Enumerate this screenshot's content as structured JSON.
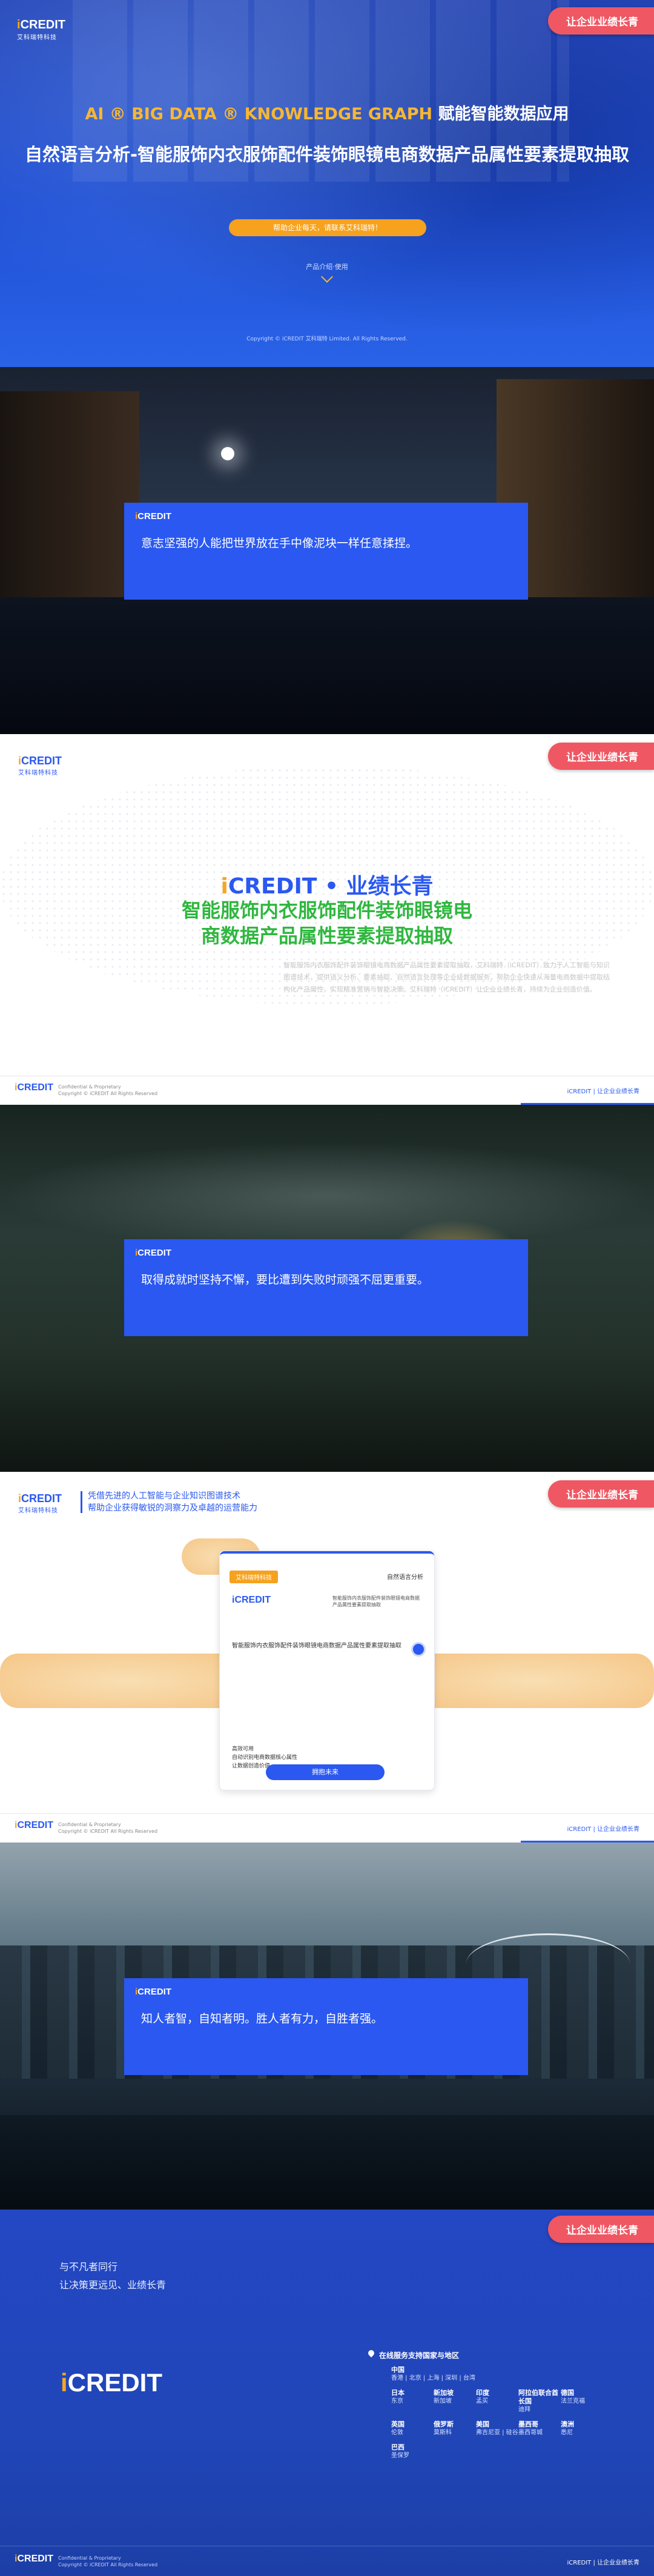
{
  "brand": {
    "logo_text": "iCREDIT",
    "logo_i": "i",
    "logo_rest": "CREDIT",
    "logo_sub": "艾科瑞特科技",
    "pill_label": "让企业业绩长青",
    "colors": {
      "primary": "#2a58f0",
      "accent": "#f5a623",
      "pill": "#ef5763",
      "green": "#2fb73f"
    }
  },
  "hero": {
    "line1_gold": "AI ® BIG DATA ® KNOWLEDGE GRAPH",
    "line1_white": "赋能智能数据应用",
    "line2": "自然语言分析-智能服饰内衣服饰配件装饰眼镜电商数据产品属性要素提取抽取",
    "cta_label": "帮助企业每天，请联系艾科瑞特！",
    "scroll_hint": "产品介绍·使用",
    "copyright": "Copyright © iCREDIT 艾科瑞特 Limited. All Rights Reserved."
  },
  "quote1": {
    "text": "意志坚强的人能把世界放在手中像泥块一样任意揉捏。"
  },
  "info": {
    "title1_i": "i",
    "title1_rest": "CREDIT • 业绩长青",
    "title2_line1": "智能服饰内衣服饰配件装饰眼镜电",
    "title2_line2": "商数据产品属性要素提取抽取",
    "body": "智能服饰内衣服饰配件装饰眼镜电商数据产品属性要素提取抽取，艾科瑞特（iCREDIT）致力于人工智能与知识图谱技术，提供语义分析、要素抽取、自然语言处理等企业级数据服务，帮助企业快速从海量电商数据中提取结构化产品属性，实现精准营销与智能决策。艾科瑞特（iCREDIT）让企业业绩长青，持续为企业创造价值。"
  },
  "footer": {
    "small_line1": "Confidential & Proprietary",
    "small_line2": "Copyright © iCREDIT All Rights Reserved",
    "right_text": "iCREDIT | 让企业业绩长青"
  },
  "quote2": {
    "text": "取得成就时坚持不懈，要比遭到失败时顽强不屈更重要。"
  },
  "product": {
    "tag_line1": "凭借先进的人工智能与企业知识图谱技术",
    "tag_line2": "帮助企业获得敏锐的洞察力及卓越的运营能力",
    "card_tab": "艾科瑞特科技",
    "card_right_title": "自然语言分析",
    "card_logo": "iCREDIT",
    "card_desc": "智能服饰内衣服饰配件装饰眼镜电商数据产品属性要素提取抽取",
    "card_main": "智能服饰内衣服饰配件装饰眼镜电商数据产品属性要素提取抽取",
    "card_list": [
      "高效可用",
      "自动识别电商数据核心属性",
      "让数据创造价值"
    ],
    "card_button": "拥抱未来"
  },
  "quote3": {
    "text": "知人者智，自知者明。胜人者有力，自胜者强。"
  },
  "contact": {
    "slogan1": "与不凡者同行",
    "slogan2": "让决策更远见、业绩长青",
    "service_title": "在线服务支持国家与地区",
    "regions": [
      {
        "name": "中国",
        "cities": "香港 | 北京 | 上海 | 深圳 | 台湾"
      },
      {
        "name": "日本",
        "cities": "东京"
      },
      {
        "name": "新加坡",
        "cities": "新加坡"
      },
      {
        "name": "印度",
        "cities": "孟买"
      },
      {
        "name": "阿拉伯联合酋长国",
        "cities": "迪拜"
      },
      {
        "name": "德国",
        "cities": "法兰克福"
      },
      {
        "name": "英国",
        "cities": "伦敦"
      },
      {
        "name": "俄罗斯",
        "cities": "莫斯科"
      },
      {
        "name": "美国",
        "cities": "弗吉尼亚 | 硅谷"
      },
      {
        "name": "墨西哥",
        "cities": "墨西哥城"
      },
      {
        "name": "澳洲",
        "cities": "悉尼"
      },
      {
        "name": "巴西",
        "cities": "圣保罗"
      }
    ]
  }
}
